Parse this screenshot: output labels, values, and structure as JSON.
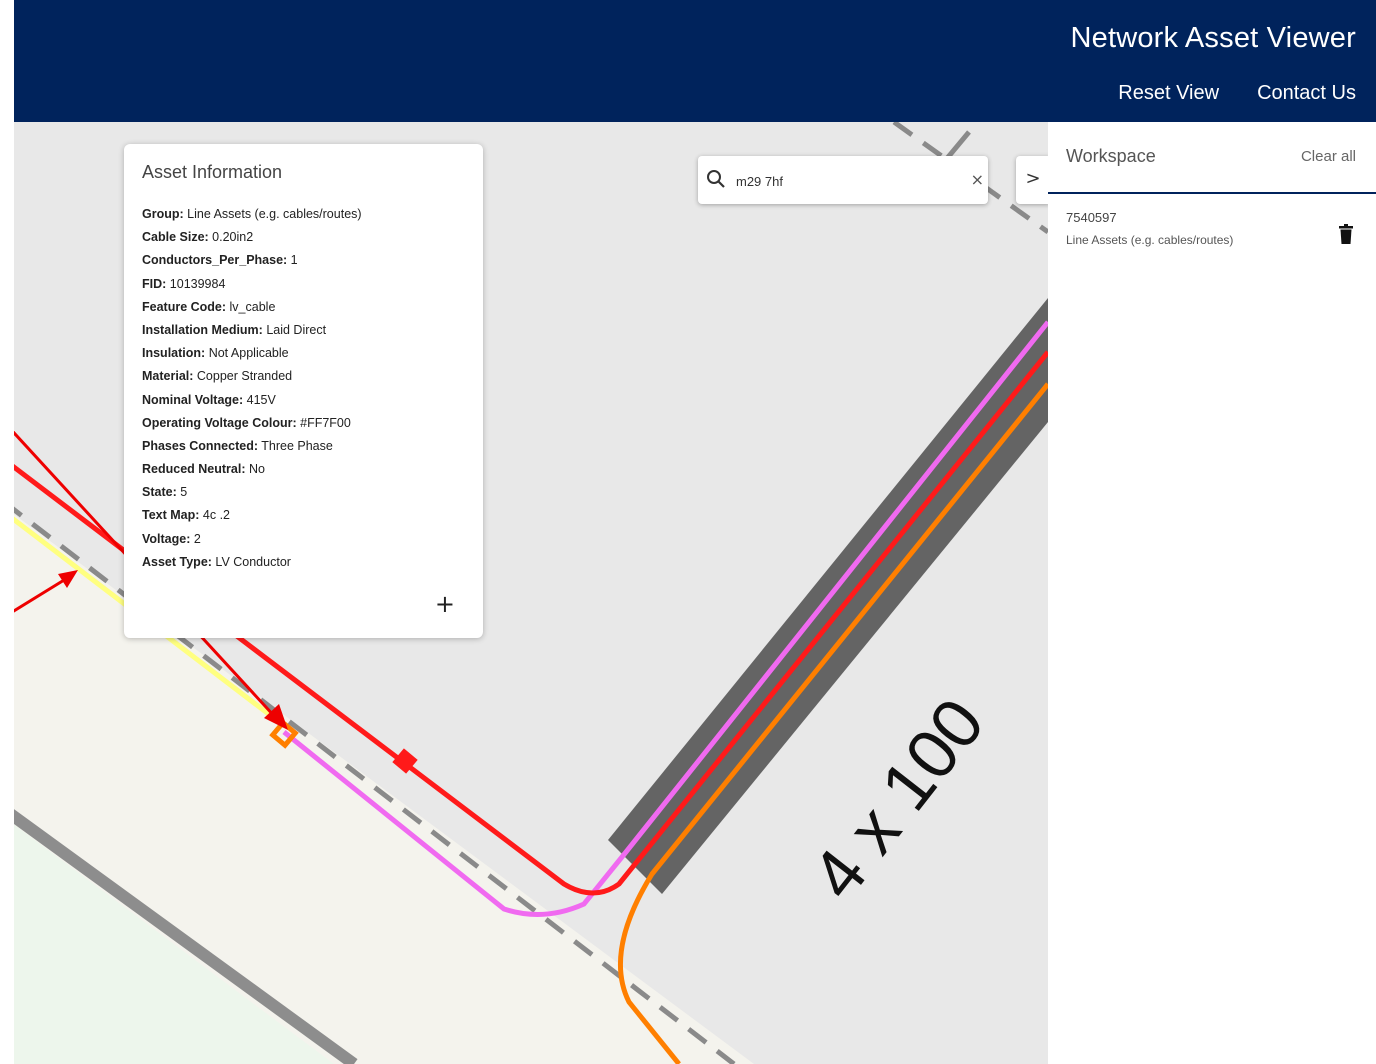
{
  "header": {
    "title": "Network Asset Viewer",
    "nav": [
      "Reset View",
      "Contact Us"
    ]
  },
  "workspace": {
    "title": "Workspace",
    "clear_label": "Clear all",
    "items": [
      {
        "id": "7540597",
        "type": "Line Assets (e.g. cables/routes)"
      }
    ]
  },
  "search": {
    "value": "m29 7hf",
    "clear": "×"
  },
  "expand_icon": ">",
  "asset_info": {
    "title": "Asset Information",
    "properties": [
      {
        "key": "Group:",
        "value": "Line Assets (e.g. cables/routes)"
      },
      {
        "key": "Cable Size:",
        "value": "0.20in2"
      },
      {
        "key": "Conductors_Per_Phase:",
        "value": "1"
      },
      {
        "key": "FID:",
        "value": "10139984"
      },
      {
        "key": "Feature Code:",
        "value": "lv_cable"
      },
      {
        "key": "Installation Medium:",
        "value": "Laid Direct"
      },
      {
        "key": "Insulation:",
        "value": "Not Applicable"
      },
      {
        "key": "Material:",
        "value": "Copper Stranded"
      },
      {
        "key": "Nominal Voltage:",
        "value": "415V"
      },
      {
        "key": "Operating Voltage Colour:",
        "value": "#FF7F00"
      },
      {
        "key": "Phases Connected:",
        "value": "Three Phase"
      },
      {
        "key": "Reduced Neutral:",
        "value": "No"
      },
      {
        "key": "State:",
        "value": "5"
      },
      {
        "key": "Text Map:",
        "value": "4c .2"
      },
      {
        "key": "Voltage:",
        "value": "2"
      },
      {
        "key": "Asset Type:",
        "value": "LV Conductor"
      }
    ],
    "add_icon": "+"
  },
  "map": {
    "label": "4 x 100",
    "colors": {
      "background": "#e8e8e8",
      "land": "#f4f3ed",
      "green": "#edf6ec",
      "duct": "#646464",
      "magenta": "#f06af0",
      "red": "#ff1a1a",
      "orange": "#ff7f00",
      "yellow": "#ffff80",
      "dashed": "#8a8a8a",
      "annotation_arrow": "#ee0000"
    }
  }
}
